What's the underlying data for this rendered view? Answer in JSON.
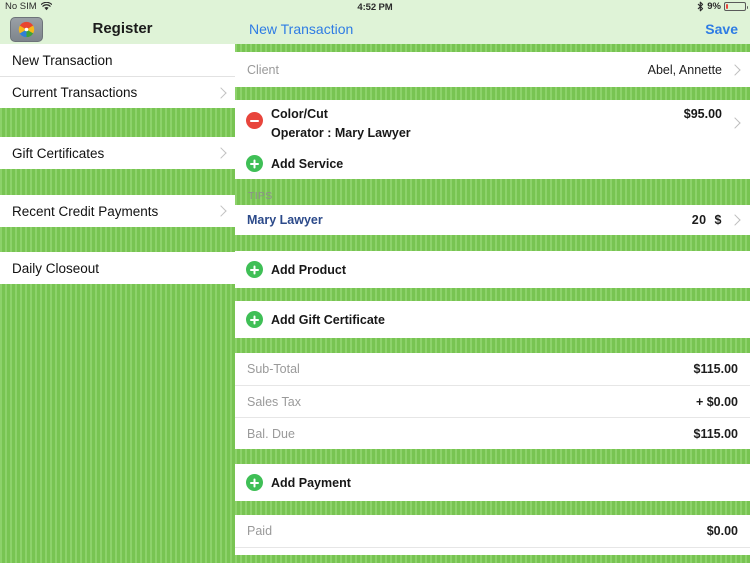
{
  "statusbar": {
    "carrier": "No SIM",
    "wifi_icon": "wifi-icon",
    "time": "4:52 PM",
    "bluetooth_icon": "bluetooth-icon",
    "battery_percent": "9%",
    "battery_level": 9
  },
  "left_panel": {
    "app_icon": "pinwheel-app-icon",
    "title": "Register",
    "groups": [
      {
        "items": [
          {
            "label": "New Transaction",
            "chevron": false
          },
          {
            "label": "Current Transactions",
            "chevron": true
          }
        ]
      },
      {
        "items": [
          {
            "label": "Gift Certificates",
            "chevron": true
          }
        ]
      },
      {
        "items": [
          {
            "label": "Recent Credit Payments",
            "chevron": true
          }
        ]
      },
      {
        "items": [
          {
            "label": "Daily Closeout",
            "chevron": false
          }
        ]
      }
    ]
  },
  "nav": {
    "title": "New Transaction",
    "save_label": "Save",
    "accent_color": "#2e7ce4"
  },
  "transaction": {
    "client_label": "Client",
    "client_value": "Abel, Annette",
    "services": [
      {
        "name": "Color/Cut",
        "operator_line": "Operator  : Mary Lawyer",
        "price": "$95.00",
        "remove_icon": "minus-circle-icon"
      }
    ],
    "add_service_label": "Add Service",
    "tips_header": "TIPS",
    "tips": [
      {
        "name": "Mary Lawyer",
        "amount": "20",
        "currency": "$"
      }
    ],
    "add_product_label": "Add Product",
    "add_gift_certificate_label": "Add Gift Certificate",
    "totals": [
      {
        "label": "Sub-Total",
        "value": "$115.00"
      },
      {
        "label": "Sales Tax",
        "value": "+ $0.00"
      },
      {
        "label": "Bal. Due",
        "value": "$115.00"
      }
    ],
    "add_payment_label": "Add Payment",
    "paid_label": "Paid",
    "paid_value": "$0.00"
  },
  "colors": {
    "green_stripe": "#7ccb55",
    "header_bg": "#dff3d7",
    "remove_red": "#e8453c",
    "add_green": "#3fbf56",
    "link_blue": "#2e7ce4",
    "tip_name_blue": "#2c4a8a"
  }
}
